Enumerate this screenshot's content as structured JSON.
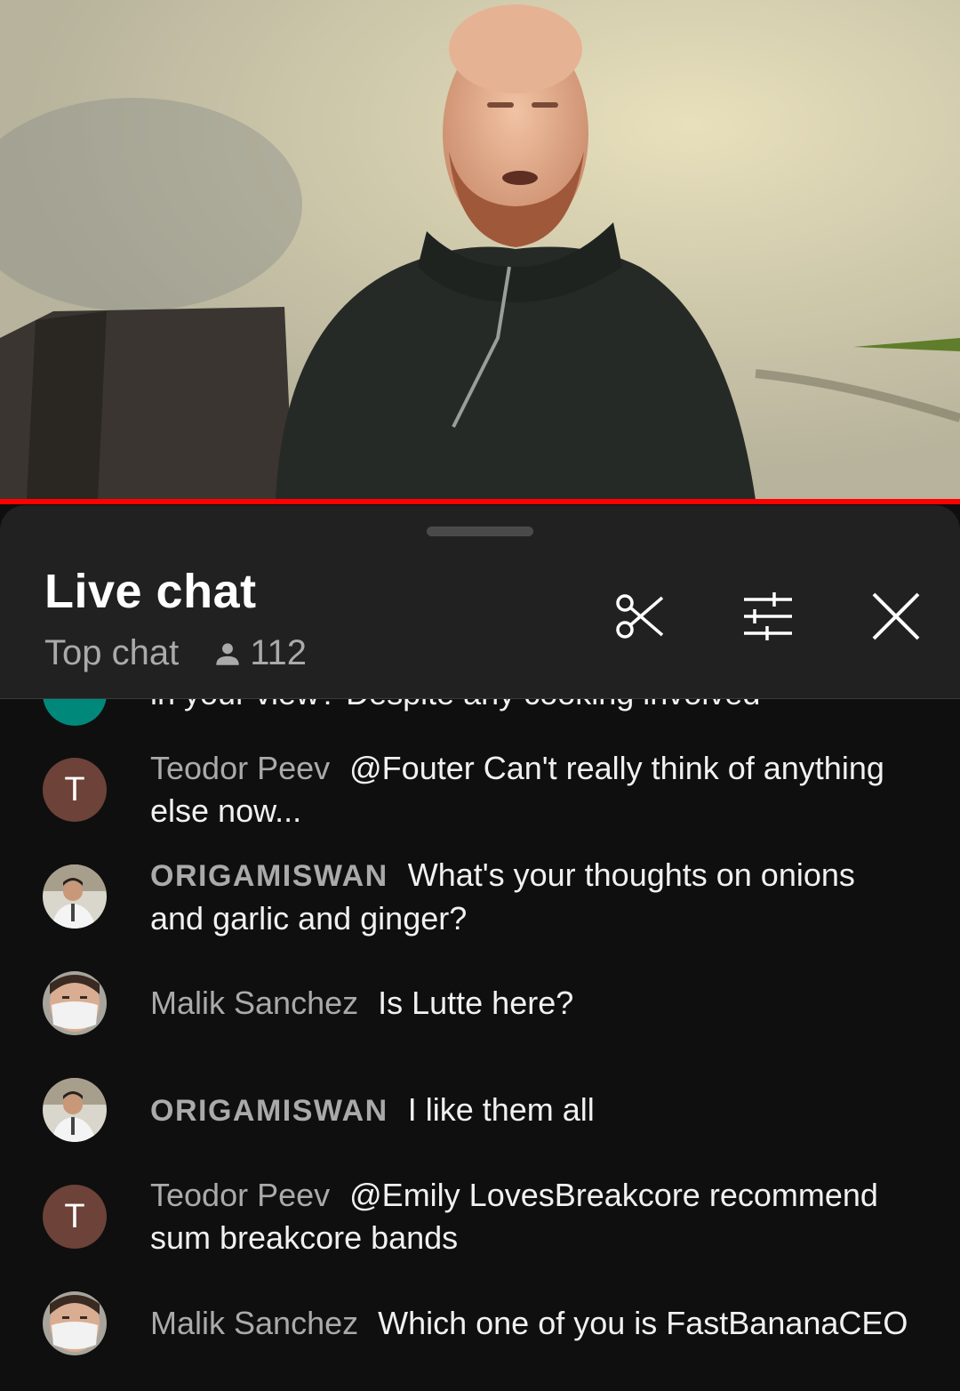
{
  "video": {
    "progress_fraction": 1.0,
    "progress_color": "#ff0000"
  },
  "chat": {
    "title": "Live chat",
    "mode": "Top chat",
    "viewer_count": "112",
    "icons": [
      "clip-icon",
      "settings-sliders-icon",
      "close-icon"
    ]
  },
  "messages": [
    {
      "author": "",
      "text": "in your view? Despite any cooking involved",
      "avatar": {
        "type": "color",
        "color": "#00897b"
      }
    },
    {
      "author": "Teodor Peev",
      "text": "@Fouter Can't really think of anything else now...",
      "avatar": {
        "type": "letter",
        "letter": "T",
        "color": "#6d4239"
      }
    },
    {
      "author": "ORIGAMISWAN",
      "text": "What's your thoughts on onions and garlic and ginger?",
      "avatar": {
        "type": "photo"
      }
    },
    {
      "author": "Malik Sanchez",
      "text": "Is Lutte here?",
      "avatar": {
        "type": "photo"
      }
    },
    {
      "author": "ORIGAMISWAN",
      "text": "I like them all",
      "avatar": {
        "type": "photo"
      }
    },
    {
      "author": "Teodor Peev",
      "text": "@Emily LovesBreakcore recommend sum breakcore bands",
      "avatar": {
        "type": "letter",
        "letter": "T",
        "color": "#6d4239"
      }
    },
    {
      "author": "Malik Sanchez",
      "text": "Which one of you is FastBananaCEO",
      "avatar": {
        "type": "photo"
      }
    }
  ]
}
